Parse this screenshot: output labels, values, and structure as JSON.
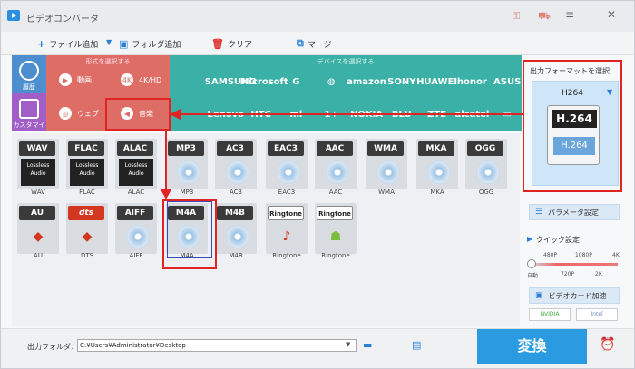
{
  "app": {
    "title": "ビデオコンバータ"
  },
  "toolbar": {
    "add_file": "ファイル追加",
    "add_folder": "フォルダ追加",
    "clear": "クリア",
    "merge": "マージ"
  },
  "categories": {
    "history": "履歴",
    "customize": "カスタマイズ",
    "format_head": "形式を選択する",
    "video": "動画",
    "hd": "4K/HD",
    "web": "ウェブ",
    "music": "音楽",
    "device_head": "デバイスを選択する",
    "brands_row1": [
      "",
      "SAMSUNG",
      "Microsoft",
      "G",
      "",
      "amazon",
      "SONY",
      "HUAWEI",
      "honor",
      "ASUS"
    ],
    "brands_row2": [
      "",
      "Lenovo",
      "HTC",
      "mi",
      "",
      "NOKIA",
      "BLU",
      "ZTE",
      "alcatel",
      ""
    ]
  },
  "formats": [
    {
      "badge": "WAV",
      "label": "WAV",
      "icon": "lossless-icon"
    },
    {
      "badge": "FLAC",
      "label": "FLAC",
      "icon": "lossless-icon"
    },
    {
      "badge": "ALAC",
      "label": "ALAC",
      "icon": "lossless-icon"
    },
    {
      "badge": "MP3",
      "label": "MP3",
      "icon": "disc-icon"
    },
    {
      "badge": "AC3",
      "label": "AC3",
      "icon": "disc-icon"
    },
    {
      "badge": "EAC3",
      "label": "EAC3",
      "icon": "disc-icon"
    },
    {
      "badge": "AAC",
      "label": "AAC",
      "icon": "disc-icon"
    },
    {
      "badge": "WMA",
      "label": "WMA",
      "icon": "disc-icon"
    },
    {
      "badge": "MKA",
      "label": "MKA",
      "icon": "disc-icon"
    },
    {
      "badge": "OGG",
      "label": "OGG",
      "icon": "disc-icon"
    },
    {
      "badge": "AU",
      "label": "AU",
      "icon": "audio-units-icon"
    },
    {
      "badge": "dts",
      "label": "DTS",
      "icon": "dts-icon"
    },
    {
      "badge": "AIFF",
      "label": "AIFF",
      "icon": "disc-icon"
    },
    {
      "badge": "M4A",
      "label": "M4A",
      "icon": "disc-icon"
    },
    {
      "badge": "M4B",
      "label": "M4B",
      "icon": "disc-icon"
    },
    {
      "badge": "Ringtone",
      "label": "Ringtone",
      "icon": "apple-ringtone-icon"
    },
    {
      "badge": "Ringtone",
      "label": "Ringtone",
      "icon": "android-ringtone-icon"
    }
  ],
  "lossless_text": "Lossless Audio",
  "right_panel": {
    "title": "出力フォーマットを選択",
    "format_name": "H264",
    "card_top": "H.264",
    "card_bottom": "H.264",
    "params": "パラメータ設定",
    "quick": "クイック設定",
    "q_top": [
      "480P",
      "1080P",
      "4K"
    ],
    "q_bottom": [
      "自動",
      "720P",
      "2K"
    ],
    "gpu": "ビデオカード加速",
    "nvidia": "NVIDIA",
    "intel": "Intel"
  },
  "bottom": {
    "out_label": "出力フォルダ：",
    "out_path": "C:¥Users¥Administrator¥Desktop",
    "convert": "変換"
  },
  "colors": {
    "accent": "#2a9be0",
    "highlight": "#e02424",
    "music_cat": "#de6d66",
    "device_cat": "#3bb0a6"
  }
}
